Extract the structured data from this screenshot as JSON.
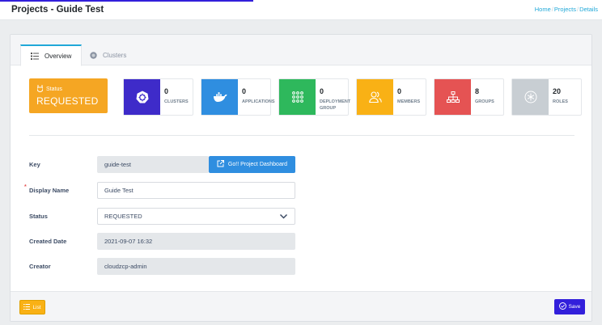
{
  "header": {
    "title": "Projects - Guide Test",
    "breadcrumb": [
      "Home",
      "Projects",
      "Details"
    ]
  },
  "tabs": [
    {
      "label": "Overview",
      "active": true
    },
    {
      "label": "Clusters",
      "active": false
    }
  ],
  "status_card": {
    "label": "Status",
    "value": "REQUESTED",
    "color": "#f5a623"
  },
  "stats": [
    {
      "value": "0",
      "label": "CLUSTERS",
      "color": "#3e2bc9",
      "icon": "kubernetes-icon"
    },
    {
      "value": "0",
      "label": "APPLICATIONS",
      "color": "#2f8ee0",
      "icon": "docker-icon"
    },
    {
      "value": "0",
      "label": "DEPLOYMENT GROUP",
      "color": "#2eb85c",
      "icon": "grid-dots-icon"
    },
    {
      "value": "0",
      "label": "MEMBERS",
      "color": "#f9b115",
      "icon": "users-icon"
    },
    {
      "value": "8",
      "label": "GROUPS",
      "color": "#e55353",
      "icon": "sitemap-icon"
    },
    {
      "value": "20",
      "label": "ROLES",
      "color": "#c8ced3",
      "icon": "asterisk-icon"
    }
  ],
  "form": {
    "key": {
      "label": "Key",
      "value": "guide-test"
    },
    "dashboard_button": "Go!! Project Dashboard",
    "display_name": {
      "label": "Display Name",
      "value": "Guide Test"
    },
    "status": {
      "label": "Status",
      "value": "REQUESTED"
    },
    "created_date": {
      "label": "Created Date",
      "value": "2021-09-07 16:32"
    },
    "creator": {
      "label": "Creator",
      "value": "cloudzcp-admin"
    }
  },
  "footer": {
    "list_label": "List",
    "save_label": "Save"
  }
}
